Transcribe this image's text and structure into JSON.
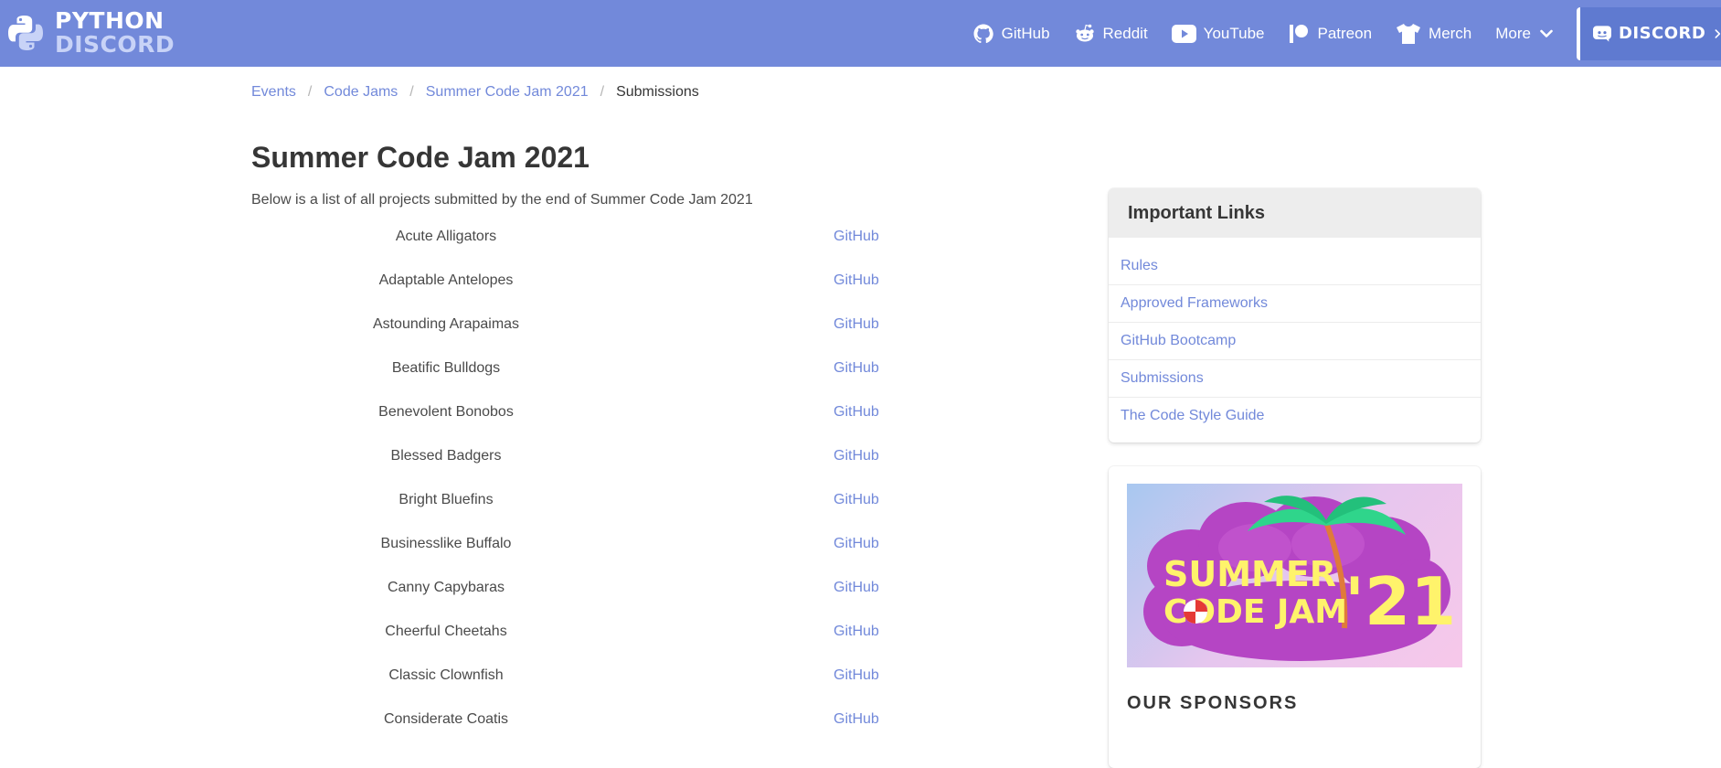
{
  "brand": {
    "line1": "PYTHON",
    "line2": "DISCORD"
  },
  "nav": {
    "items": [
      {
        "label": "GitHub",
        "icon": "github-icon"
      },
      {
        "label": "Reddit",
        "icon": "reddit-icon"
      },
      {
        "label": "YouTube",
        "icon": "youtube-icon"
      },
      {
        "label": "Patreon",
        "icon": "patreon-icon"
      },
      {
        "label": "Merch",
        "icon": "tshirt-icon"
      }
    ],
    "more": "More",
    "discord": "DISCORD"
  },
  "breadcrumb": [
    "Events",
    "Code Jams",
    "Summer Code Jam 2021",
    "Submissions"
  ],
  "title": "Summer Code Jam 2021",
  "intro": "Below is a list of all projects submitted by the end of Summer Code Jam 2021",
  "projects": [
    {
      "name": "Acute Alligators",
      "link": "GitHub"
    },
    {
      "name": "Adaptable Antelopes",
      "link": "GitHub"
    },
    {
      "name": "Astounding Arapaimas",
      "link": "GitHub"
    },
    {
      "name": "Beatific Bulldogs",
      "link": "GitHub"
    },
    {
      "name": "Benevolent Bonobos",
      "link": "GitHub"
    },
    {
      "name": "Blessed Badgers",
      "link": "GitHub"
    },
    {
      "name": "Bright Bluefins",
      "link": "GitHub"
    },
    {
      "name": "Businesslike Buffalo",
      "link": "GitHub"
    },
    {
      "name": "Canny Capybaras",
      "link": "GitHub"
    },
    {
      "name": "Cheerful Cheetahs",
      "link": "GitHub"
    },
    {
      "name": "Classic Clownfish",
      "link": "GitHub"
    },
    {
      "name": "Considerate Coatis",
      "link": "GitHub"
    }
  ],
  "sidebar": {
    "links_title": "Important Links",
    "links": [
      "Rules",
      "Approved Frameworks",
      "GitHub Bootcamp",
      "Submissions",
      "The Code Style Guide"
    ],
    "banner": {
      "line1": "SUMMER",
      "line2": "CODE JAM",
      "year": "'21"
    },
    "sponsors_title": "OUR SPONSORS"
  },
  "colors": {
    "accent": "#7289da",
    "navbar": "#7289da",
    "text": "#363636"
  }
}
